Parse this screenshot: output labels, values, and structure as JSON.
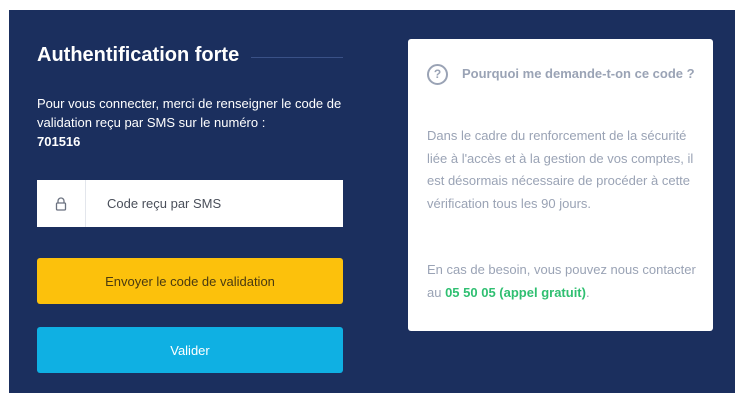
{
  "auth": {
    "title": "Authentification forte",
    "intro": "Pour vous connecter, merci de renseigner le code de validation reçu par SMS sur le numéro :",
    "phone": "701516",
    "code_placeholder": "Code reçu par SMS",
    "send_button": "Envoyer le code de validation",
    "validate_button": "Valider"
  },
  "info": {
    "icon": "question-circle-icon",
    "heading": "Pourquoi me demande-t-on ce code ?",
    "paragraph1": "Dans le cadre du renforcement de la sécurité liée à l'accès et à la gestion de vos comptes, il est désormais nécessaire de procéder à cette vérification tous les 90 jours.",
    "paragraph2_prefix": "En cas de besoin, vous pouvez nous contacter au ",
    "contact_number": "05 50 05 (appel gratuit)",
    "paragraph2_suffix": "."
  },
  "colors": {
    "panel_bg": "#1b2f5e",
    "send_button": "#fcc10c",
    "validate_button": "#0fb0e3",
    "contact_green": "#2fbf71",
    "info_text": "#9aa3b5"
  },
  "icons": {
    "lock": "lock-icon",
    "question": "question-circle-icon"
  }
}
